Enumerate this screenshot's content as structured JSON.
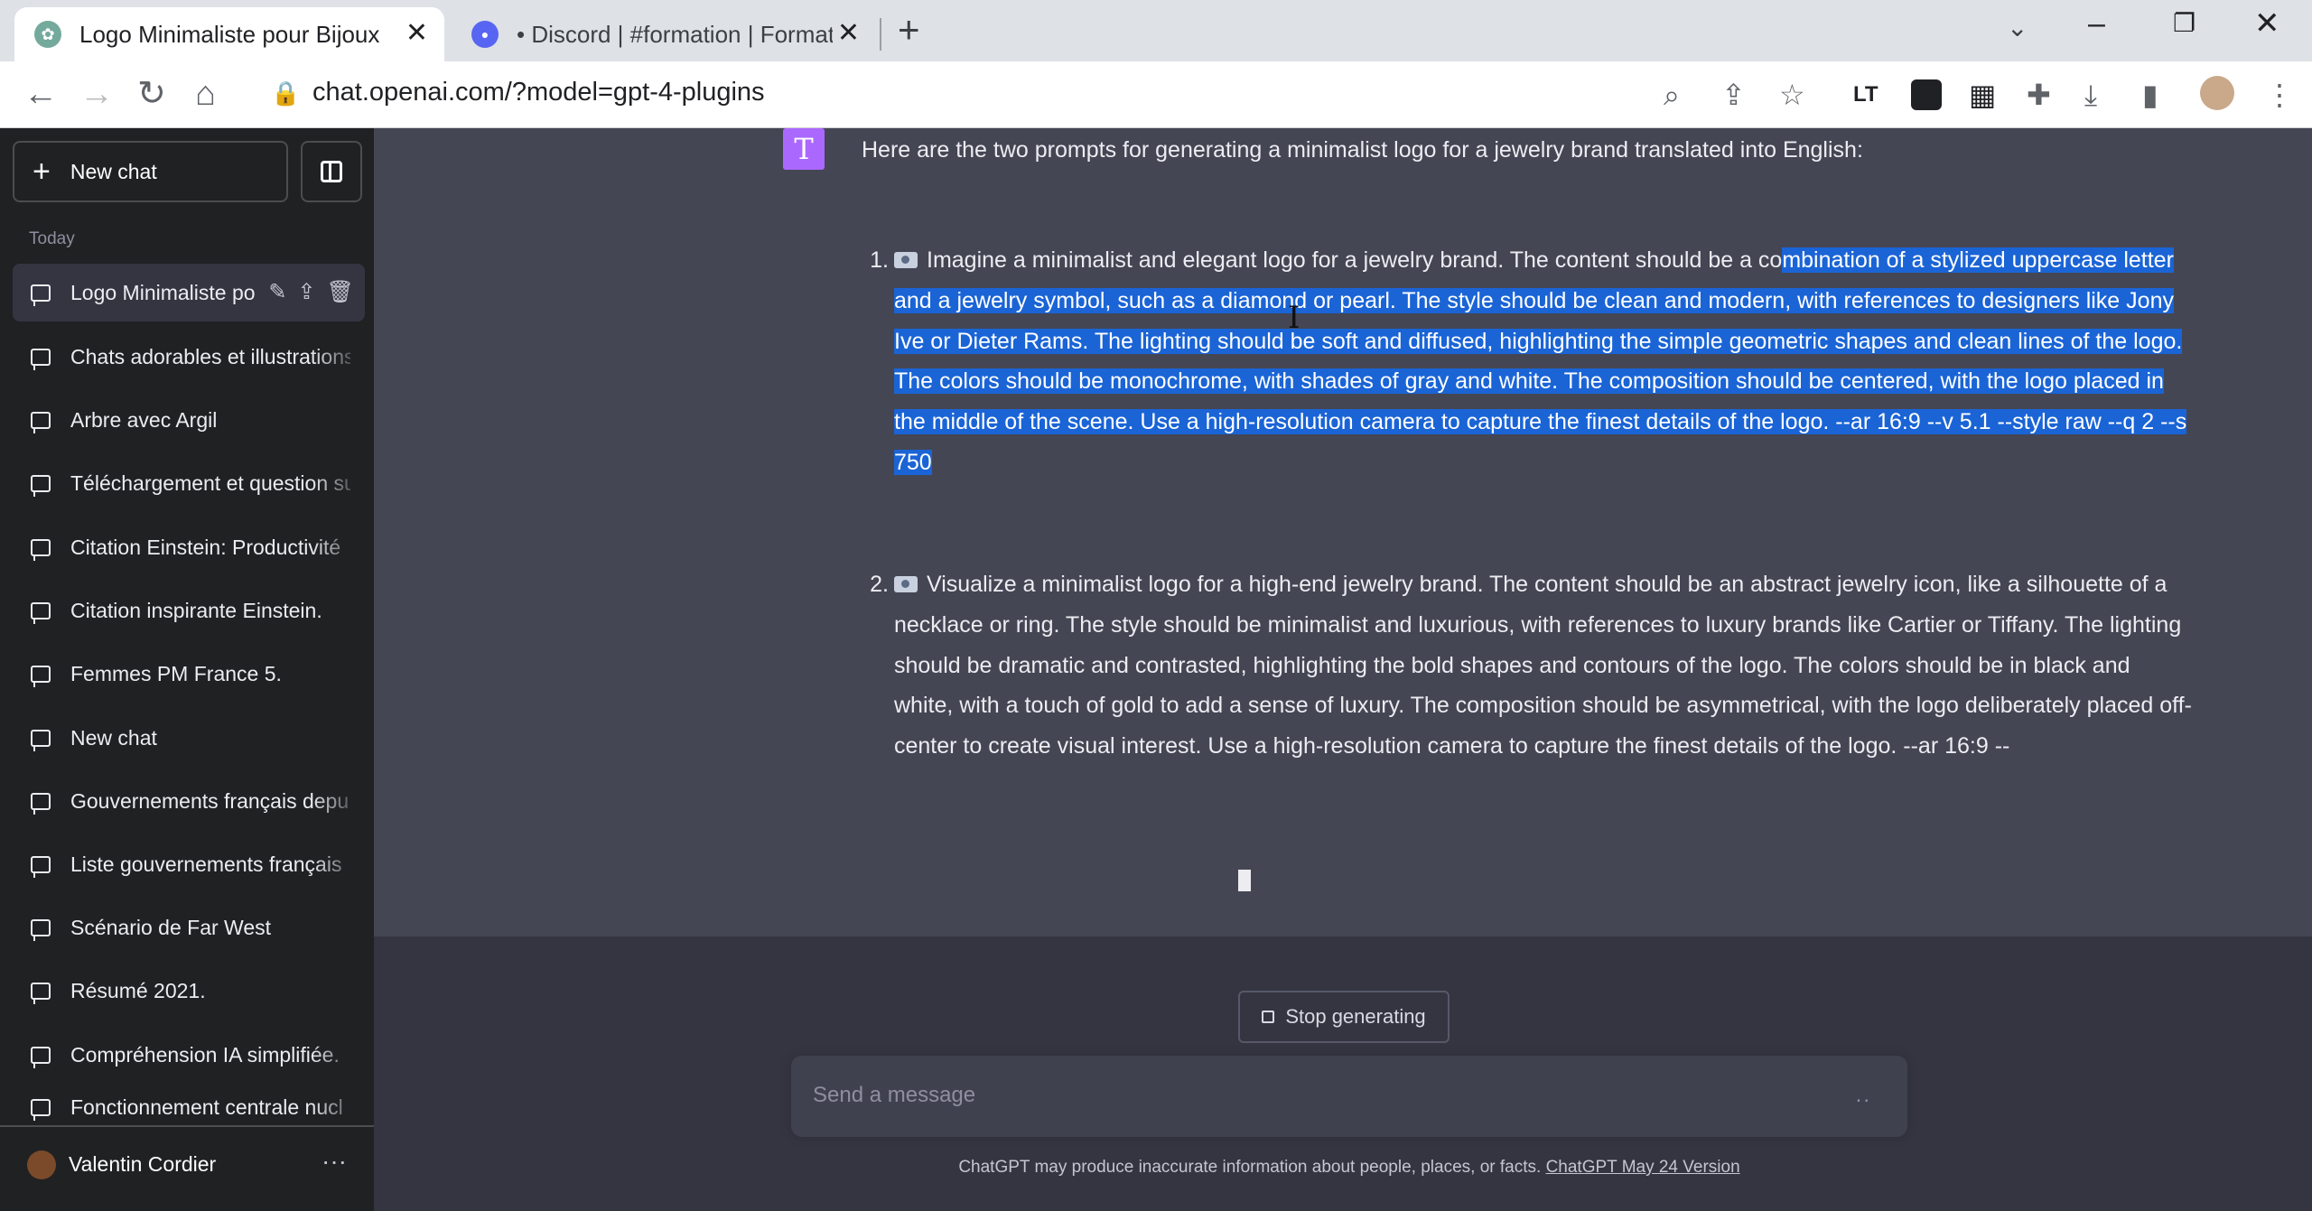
{
  "browser": {
    "tabs": [
      {
        "title": "Logo Minimaliste pour Bijoux",
        "close": "✕"
      },
      {
        "title": "• Discord | #formation | Formatio",
        "close": "✕"
      }
    ],
    "new_tab": "+",
    "tab_search": "⌄",
    "window": {
      "minimize": "–",
      "restore": "❐",
      "close": "✕"
    },
    "url": "chat.openai.com/?model=gpt-4-plugins",
    "extensions": {
      "languagetool": "LT"
    }
  },
  "sidebar": {
    "new_chat": "New chat",
    "section": "Today",
    "items": [
      {
        "label": "Logo Minimaliste po"
      },
      {
        "label": "Chats adorables et illustrations"
      },
      {
        "label": "Arbre avec Argil"
      },
      {
        "label": "Téléchargement et question su"
      },
      {
        "label": "Citation Einstein: Productivité"
      },
      {
        "label": "Citation inspirante Einstein."
      },
      {
        "label": "Femmes PM France 5."
      },
      {
        "label": "New chat"
      },
      {
        "label": "Gouvernements français depu"
      },
      {
        "label": "Liste gouvernements français"
      },
      {
        "label": "Scénario de Far West"
      },
      {
        "label": "Résumé 2021."
      },
      {
        "label": "Compréhension IA simplifiée."
      },
      {
        "label": "Fonctionnement centrale nucl"
      }
    ],
    "user": {
      "name": "Valentin Cordier",
      "more": "···"
    }
  },
  "message": {
    "avatar_letter": "T",
    "intro": "Here are the two prompts for generating a minimalist logo for a jewelry brand translated into English:",
    "items": [
      {
        "number": "1.",
        "lead": "Imagine a minimalist and elegant logo for a jewelry brand. The content should be a co",
        "selected": "mbination of a stylized uppercase letter and a jewelry symbol, such as a diamond or pearl. The style should be clean and modern, with references to designers like Jony Ive or Dieter Rams. The lighting should be soft and diffused, highlighting the simple geometric shapes and clean lines of the logo. The colors should be monochrome, with shades of gray and white. The composition should be centered, with the logo placed in the middle of the scene. Use a high-resolution camera to capture the finest details of the logo. --ar 16:9 --v 5.1 --style raw --q 2 --s 750"
      },
      {
        "number": "2.",
        "text": "Visualize a minimalist logo for a high-end jewelry brand. The content should be an abstract jewelry icon, like a silhouette of a necklace or ring. The style should be minimalist and luxurious, with references to luxury brands like Cartier or Tiffany. The lighting should be dramatic and contrasted, highlighting the bold shapes and contours of the logo. The colors should be in black and white, with a touch of gold to add a sense of luxury. The composition should be asymmetrical, with the logo deliberately placed off-center to create visual interest. Use a high-resolution camera to capture the finest details of the logo. --ar 16:9 --"
      }
    ]
  },
  "composer": {
    "stop": "Stop generating",
    "placeholder": "Send a message",
    "dots": "..",
    "disclaimer": "ChatGPT may produce inaccurate information about people, places, or facts.",
    "version_link": "ChatGPT May 24 Version"
  }
}
